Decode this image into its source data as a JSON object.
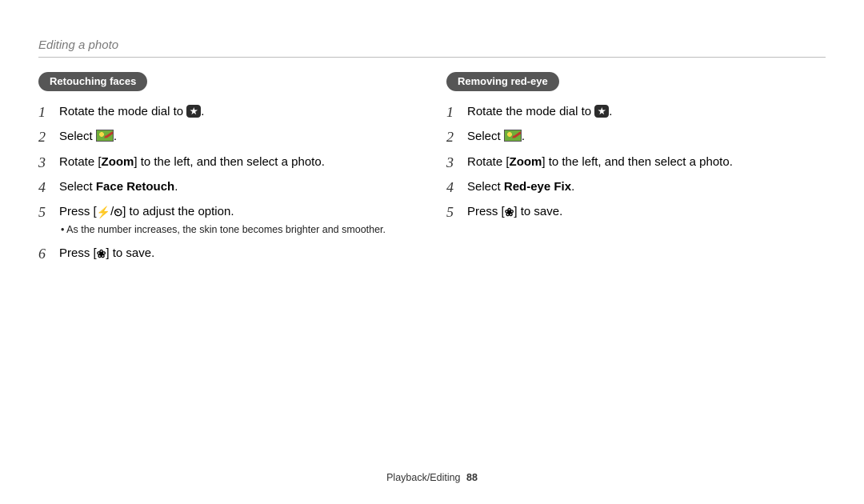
{
  "header": {
    "title": "Editing a photo"
  },
  "left": {
    "heading": "Retouching faces",
    "steps": [
      {
        "n": "1",
        "pre": "Rotate the mode dial to ",
        "icon": "mode",
        "post": "."
      },
      {
        "n": "2",
        "pre": "Select ",
        "icon": "thumb",
        "post": "."
      },
      {
        "n": "3",
        "parts": [
          "Rotate [",
          "Zoom",
          "] to the left, and then select a photo."
        ]
      },
      {
        "n": "4",
        "parts": [
          "Select ",
          "Face Retouch",
          "."
        ]
      },
      {
        "n": "5",
        "body": "Press [ ⯈ / ⟳ ] to adjust the option.",
        "pre": "Press [",
        "icon": "flash-timer",
        "post": "] to adjust the option.",
        "note": "As the number increases, the skin tone becomes brighter and smoother."
      },
      {
        "n": "6",
        "pre": "Press [",
        "icon": "macro",
        "post": "] to save."
      }
    ]
  },
  "right": {
    "heading": "Removing red-eye",
    "steps": [
      {
        "n": "1",
        "pre": "Rotate the mode dial to ",
        "icon": "mode",
        "post": "."
      },
      {
        "n": "2",
        "pre": "Select ",
        "icon": "thumb",
        "post": "."
      },
      {
        "n": "3",
        "parts": [
          "Rotate [",
          "Zoom",
          "] to the left, and then select a photo."
        ]
      },
      {
        "n": "4",
        "parts": [
          "Select ",
          "Red-eye Fix",
          "."
        ]
      },
      {
        "n": "5",
        "pre": "Press [",
        "icon": "macro",
        "post": "] to save."
      }
    ]
  },
  "footer": {
    "section": "Playback/Editing",
    "page": "88"
  },
  "glyphs": {
    "flash": "⚡",
    "timer": "⏲",
    "macro": "❀"
  }
}
